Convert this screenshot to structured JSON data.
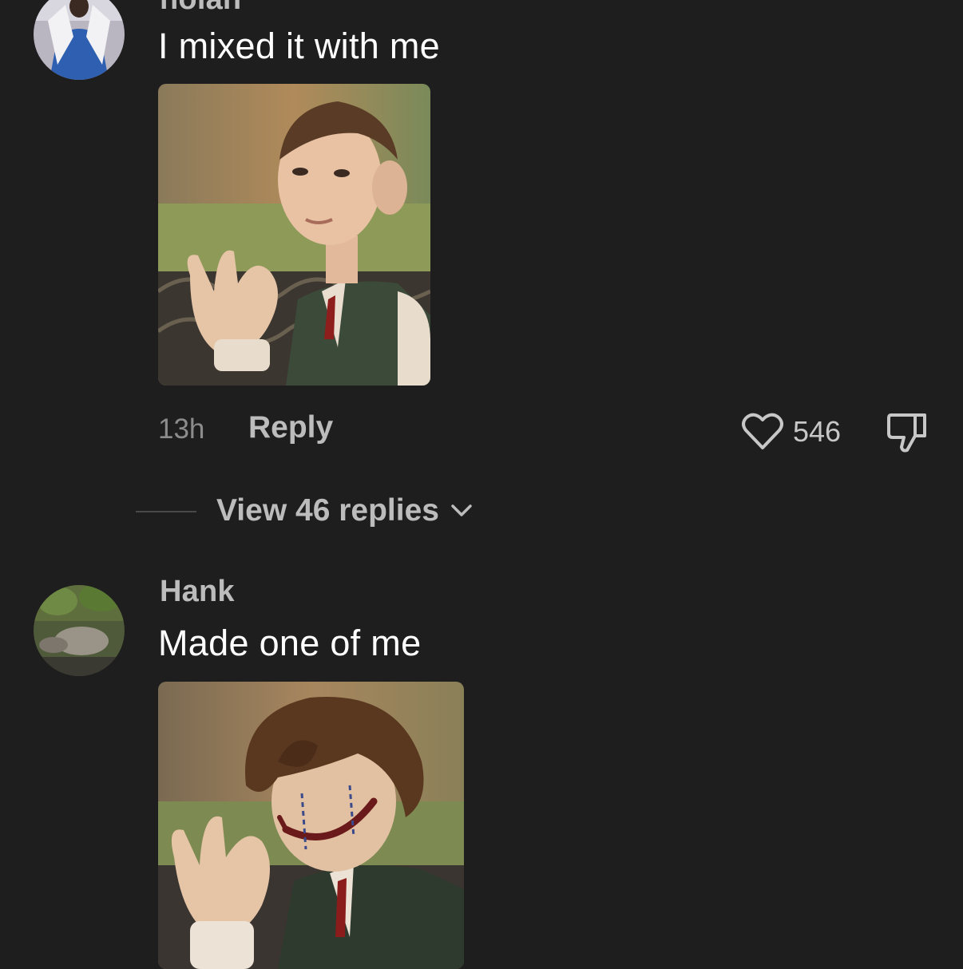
{
  "comments": [
    {
      "username": "nolan",
      "text": "I mixed it with me",
      "avatar_icon": "user-avatar-icon",
      "attachment": "claymation-boy-ok-sign-photo",
      "time": "13h",
      "reply_label": "Reply",
      "likes": "546",
      "view_replies_label": "View 46 replies"
    },
    {
      "username": "Hank",
      "text": "Made one of me",
      "avatar_icon": "user-avatar-icon",
      "attachment": "joker-makeup-boy-ok-sign-photo"
    }
  ],
  "colors": {
    "background": "#1f1e1f",
    "primary_text": "#ffffff",
    "secondary_text": "#bdbcbd",
    "muted_text": "#8d8c8d"
  },
  "icons": {
    "like": "heart-outline-icon",
    "dislike": "thumbs-down-outline-icon",
    "expand": "chevron-down-icon"
  }
}
